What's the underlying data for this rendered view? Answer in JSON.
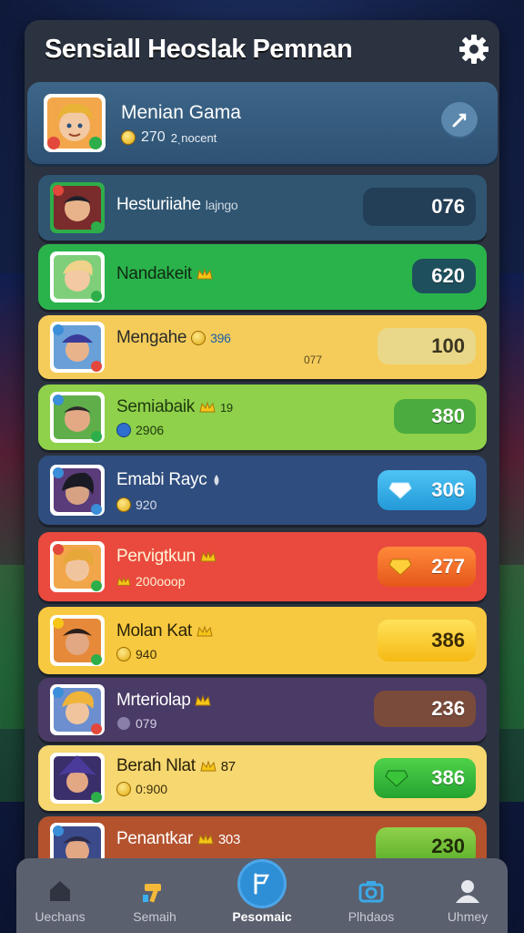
{
  "header": {
    "title": "Sensiall Heoslak Pemnan"
  },
  "featured": {
    "name": "Menian Gama",
    "coins": "270",
    "sub": "2ˎnocent"
  },
  "players": [
    {
      "name": "Hesturiiahe",
      "tag": "lajngo",
      "sub": "",
      "score": "076"
    },
    {
      "name": "Nandakeit",
      "tag": "",
      "sub": "",
      "score": "620"
    },
    {
      "name": "Mengahe",
      "tag": "396",
      "sub": "077",
      "score": "100"
    },
    {
      "name": "Semiabaik",
      "tag": "19",
      "sub": "2906",
      "score": "380"
    },
    {
      "name": "Emabi Rayc",
      "tag": "",
      "sub": "920",
      "score": "306"
    },
    {
      "name": "Pervigtkun",
      "tag": "",
      "sub": "200ooop",
      "score": "277"
    },
    {
      "name": "Molan Kat",
      "tag": "",
      "sub": "940",
      "score": "386"
    },
    {
      "name": "Mrteriolap",
      "tag": "",
      "sub": "079",
      "score": "236"
    },
    {
      "name": "Berah Nlat",
      "tag": "87",
      "sub": "0:900",
      "score": "386"
    },
    {
      "name": "Penantkar",
      "tag": "303",
      "sub": "",
      "score": "230"
    }
  ],
  "nav": [
    {
      "label": "Uechans",
      "icon": "home-icon"
    },
    {
      "label": "Semaih",
      "icon": "hammer-icon"
    },
    {
      "label": "Pesomaic",
      "icon": "flag-icon"
    },
    {
      "label": "Plhdaos",
      "icon": "camera-icon"
    },
    {
      "label": "Uhmey",
      "icon": "profile-icon"
    }
  ],
  "colors": {
    "accent": "#2e8fd6",
    "panel": "#2b3240",
    "row_green": "#27b04a",
    "row_red": "#e8493e",
    "row_yellow": "#f5cc4e"
  }
}
